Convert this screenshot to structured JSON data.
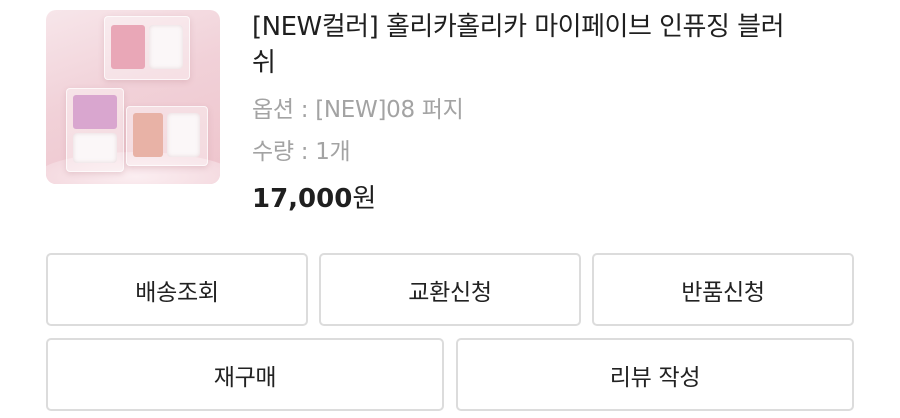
{
  "product": {
    "title": "[NEW컬러] 홀리카홀리카 마이페이브 인퓨징 블러쉬",
    "option": "옵션 : [NEW]08 퍼지",
    "quantity": "수량 : 1개",
    "price_amount": "17,000",
    "price_unit": "원",
    "thumbnail": "product-image-blush-palettes"
  },
  "actions": {
    "track_delivery": "배송조회",
    "exchange_request": "교환신청",
    "return_request": "반품신청",
    "reorder": "재구매",
    "write_review": "리뷰 작성"
  }
}
